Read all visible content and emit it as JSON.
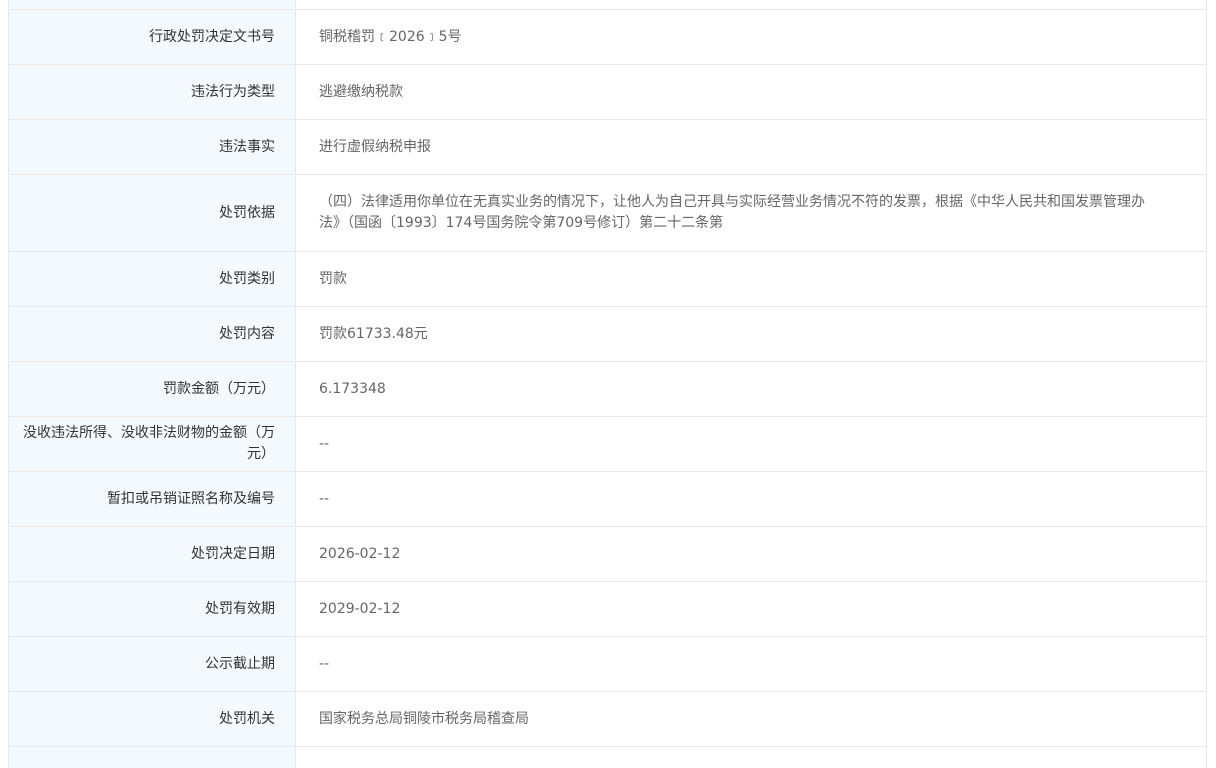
{
  "rows": [
    {
      "label": "",
      "value": ""
    },
    {
      "label": "行政处罚决定文书号",
      "value": "铜税稽罚﹝2026﹞5号"
    },
    {
      "label": "违法行为类型",
      "value": "逃避缴纳税款"
    },
    {
      "label": "违法事实",
      "value": "进行虚假纳税申报"
    },
    {
      "label": "处罚依据",
      "value": "（四）法律适用你单位在无真实业务的情况下，让他人为自己开具与实际经营业务情况不符的发票，根据《中华人民共和国发票管理办法》（国函〔1993〕174号国务院令第709号修订）第二十二条第"
    },
    {
      "label": "处罚类别",
      "value": "罚款"
    },
    {
      "label": "处罚内容",
      "value": "罚款61733.48元"
    },
    {
      "label": "罚款金额（万元）",
      "value": "6.173348"
    },
    {
      "label": "没收违法所得、没收非法财物的金额（万元）",
      "value": "--"
    },
    {
      "label": "暂扣或吊销证照名称及编号",
      "value": "--"
    },
    {
      "label": "处罚决定日期",
      "value": "2026-02-12"
    },
    {
      "label": "处罚有效期",
      "value": "2029-02-12"
    },
    {
      "label": "公示截止期",
      "value": "--"
    },
    {
      "label": "处罚机关",
      "value": "国家税务总局铜陵市税务局稽查局"
    },
    {
      "label": "",
      "value": ""
    }
  ]
}
